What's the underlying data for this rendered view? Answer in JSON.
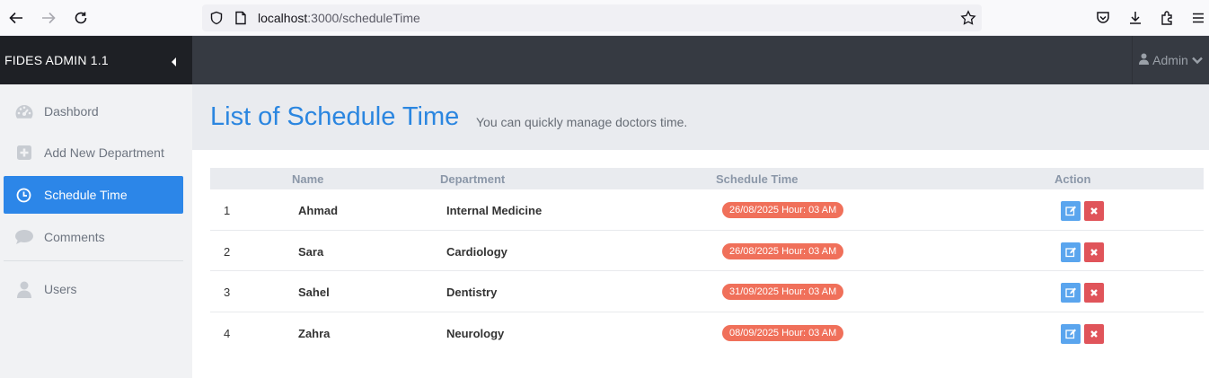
{
  "browser": {
    "url_host": "localhost",
    "url_path": ":3000/scheduleTime"
  },
  "header": {
    "brand": "FIDES ADMIN 1.1",
    "user_label": "Admin"
  },
  "sidebar": {
    "items": [
      {
        "label": "Dashbord",
        "icon": "dashboard-icon"
      },
      {
        "label": "Add New Department",
        "icon": "plus-square-icon"
      },
      {
        "label": "Schedule Time",
        "icon": "clock-icon",
        "active": true
      },
      {
        "label": "Comments",
        "icon": "comment-icon"
      },
      {
        "label": "Users",
        "icon": "user-icon"
      }
    ]
  },
  "page": {
    "title": "List of Schedule Time",
    "subtitle": "You can quickly manage doctors time."
  },
  "table": {
    "columns": [
      "Name",
      "Department",
      "Schedule Time",
      "Action"
    ],
    "rows": [
      {
        "num": "1",
        "name": "Ahmad",
        "department": "Internal Medicine",
        "time": "26/08/2025 Hour: 03 AM"
      },
      {
        "num": "2",
        "name": "Sara",
        "department": "Cardiology",
        "time": "26/08/2025 Hour: 03 AM"
      },
      {
        "num": "3",
        "name": "Sahel",
        "department": "Dentistry",
        "time": "31/09/2025 Hour: 03 AM"
      },
      {
        "num": "4",
        "name": "Zahra",
        "department": "Neurology",
        "time": "08/09/2025 Hour: 03 AM"
      }
    ]
  },
  "colors": {
    "accent": "#2c86e8",
    "badge": "#f0705a",
    "edit": "#5aa5ee",
    "delete": "#e0545a"
  }
}
